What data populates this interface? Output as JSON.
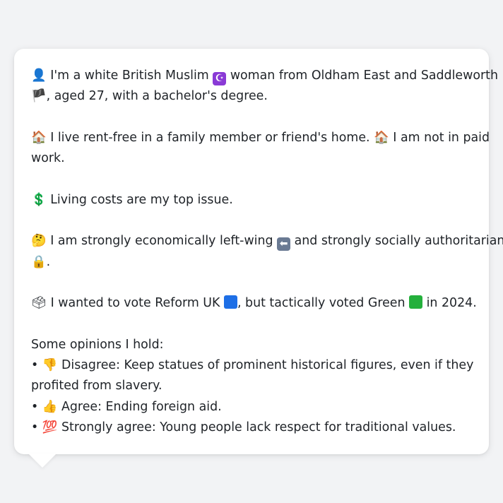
{
  "persona": {
    "identity_line1": "I'm a white British Muslim",
    "identity_line1b": "woman from Oldham East and Saddleworth",
    "identity_line2": ", aged 27, with a bachelor's degree.",
    "housing_a": "I live rent-free in a family member or friend's home.",
    "housing_b": "I am not in paid",
    "housing_c": "work.",
    "issue": "Living costs are my top issue.",
    "politics_a": "I am strongly economically left-wing",
    "politics_b": "and strongly socially authoritarian",
    "politics_c": ".",
    "vote_a": "I wanted to vote Reform UK",
    "vote_b": ", but tactically voted Green",
    "vote_c": "in 2024.",
    "opinions_header": "Some opinions I hold:",
    "opinion1_a": "Disagree: Keep statues of prominent historical figures, even if they",
    "opinion1_b": "profited from slavery.",
    "opinion2": "Agree: Ending foreign aid.",
    "opinion3": "Strongly agree: Young people lack respect for traditional values."
  },
  "icons": {
    "person": "👤",
    "crescent": "☪",
    "england_flag": "🏴",
    "house": "🏠",
    "dollar": "💲",
    "thinking": "🤔",
    "left_arrow": "⬅",
    "lock": "🔒",
    "ballot": "🗳",
    "thumbs_down": "👎",
    "thumbs_up": "👍",
    "hundred": "💯",
    "bullet": "•"
  },
  "colors": {
    "party_reform": "#1e6fe6",
    "party_green": "#24b03c",
    "background": "#f2f3f5"
  }
}
